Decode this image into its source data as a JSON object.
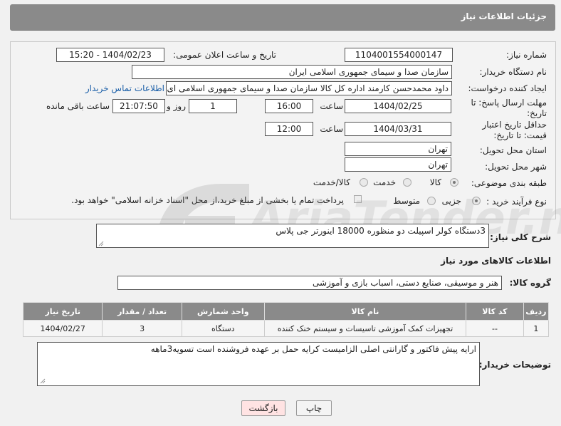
{
  "header": {
    "title": "جزئیات اطلاعات نیاز"
  },
  "form": {
    "need_number_label": "شماره نیاز:",
    "need_number": "1104001554000147",
    "announce_date_label": "تاریخ و ساعت اعلان عمومی:",
    "announce_date": "1404/02/23 - 15:20",
    "buyer_org_label": "نام دستگاه خریدار:",
    "buyer_org": "سازمان صدا و سیمای جمهوری اسلامی ایران",
    "creator_label": "ایجاد کننده درخواست:",
    "creator": "داود محمدحسن کارمند اداره کل کالا سازمان صدا و سیمای جمهوری اسلامی ای",
    "buyer_contact_link": "اطلاعات تماس خریدار",
    "reply_deadline_label": "مهلت ارسال پاسخ: تا تاریخ:",
    "reply_date": "1404/02/25",
    "time_label": "ساعت",
    "reply_time": "16:00",
    "days_value": "1",
    "days_label": "روز و",
    "remaining_time": "21:07:50",
    "remaining_label": "ساعت باقی مانده",
    "price_valid_label": "حداقل تاریخ اعتبار قیمت: تا تاریخ:",
    "price_valid_date": "1404/03/31",
    "price_time_label": "ساعت",
    "price_valid_time": "12:00",
    "province_label": "استان محل تحویل:",
    "province": "تهران",
    "city_label": "شهر محل تحویل:",
    "city": "تهران",
    "category_label": "طبقه بندی موضوعی:",
    "category_options": [
      "کالا",
      "خدمت",
      "کالا/خدمت"
    ],
    "category_selected": "کالا",
    "process_label": "نوع فرآیند خرید :",
    "process_options": [
      "جزیی",
      "متوسط"
    ],
    "process_selected": "جزیی",
    "payment_note": "پرداخت تمام یا بخشی از مبلغ خرید،از محل \"اسناد خزانه اسلامی\" خواهد بود."
  },
  "description": {
    "label": "شرح کلی نیاز:",
    "text": "3دستگاه کولر اسپیلت دو منظوره 18000 اینورتر جی پلاس"
  },
  "goods_info": {
    "title": "اطلاعات کالاهای مورد نیاز",
    "group_label": "گروه کالا:",
    "group_value": "هنر و موسیقی، صنایع دستی، اسباب بازی و آموزشی"
  },
  "table": {
    "headers": [
      "ردیف",
      "کد کالا",
      "نام کالا",
      "واحد شمارش",
      "تعداد / مقدار",
      "تاریخ نیاز"
    ],
    "rows": [
      [
        "1",
        "--",
        "تجهیزات کمک آموزشی تاسیسات و سیستم خنک کننده",
        "دستگاه",
        "3",
        "1404/02/27"
      ]
    ]
  },
  "buyer_notes": {
    "label": "توضیحات خریدار:",
    "text": "ارایه پیش فاکتور و گارانتی اصلی الزامیست کرایه حمل بر عهده فروشنده است تسویه3ماهه"
  },
  "buttons": {
    "print": "چاپ",
    "back": "بازگشت"
  },
  "colors": {
    "header_bg": "#8a8a8a",
    "link": "#1b5fa8",
    "back_button_bg": "#ffe3e3"
  }
}
